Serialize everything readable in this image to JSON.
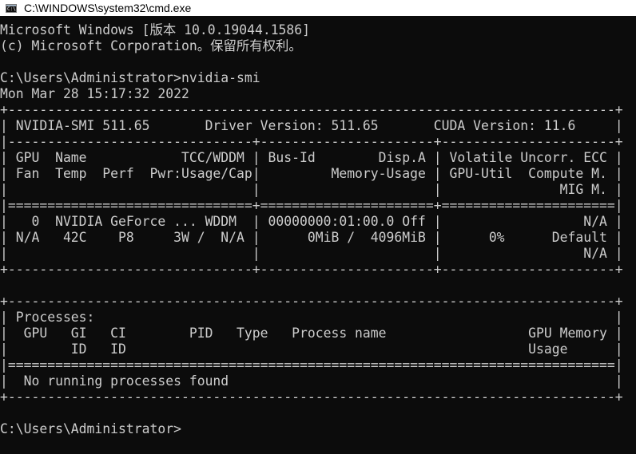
{
  "window": {
    "title": "C:\\WINDOWS\\system32\\cmd.exe",
    "icon": "cmd-icon",
    "icon_text": "C:\\"
  },
  "console": {
    "lines": [
      "Microsoft Windows [版本 10.0.19044.1586]",
      "(c) Microsoft Corporation。保留所有权利。",
      "",
      "C:\\Users\\Administrator>nvidia-smi",
      "Mon Mar 28 15:17:32 2022",
      "+-----------------------------------------------------------------------------+",
      "| NVIDIA-SMI 511.65       Driver Version: 511.65       CUDA Version: 11.6     |",
      "|-------------------------------+----------------------+----------------------+",
      "| GPU  Name            TCC/WDDM | Bus-Id        Disp.A | Volatile Uncorr. ECC |",
      "| Fan  Temp  Perf  Pwr:Usage/Cap|         Memory-Usage | GPU-Util  Compute M. |",
      "|                               |                      |               MIG M. |",
      "|===============================+======================+======================|",
      "|   0  NVIDIA GeForce ... WDDM  | 00000000:01:00.0 Off |                  N/A |",
      "| N/A   42C    P8     3W /  N/A |      0MiB /  4096MiB |      0%      Default |",
      "|                               |                      |                  N/A |",
      "+-------------------------------+----------------------+----------------------+",
      "",
      "+-----------------------------------------------------------------------------+",
      "| Processes:                                                                  |",
      "|  GPU   GI   CI        PID   Type   Process name                  GPU Memory |",
      "|        ID   ID                                                   Usage      |",
      "|=============================================================================|",
      "|  No running processes found                                                 |",
      "+-----------------------------------------------------------------------------+",
      "",
      "C:\\Users\\Administrator>"
    ]
  }
}
